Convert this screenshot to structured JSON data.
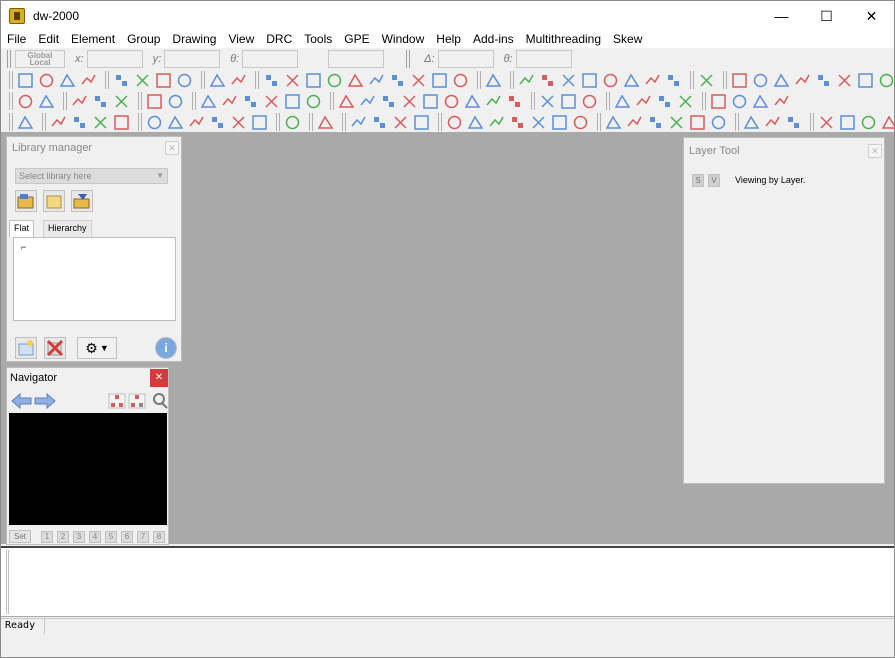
{
  "window": {
    "title": "dw-2000",
    "minimize_glyph": "—",
    "maximize_glyph": "☐",
    "close_glyph": "✕"
  },
  "menu": [
    "File",
    "Edit",
    "Element",
    "Group",
    "Drawing",
    "View",
    "DRC",
    "Tools",
    "GPE",
    "Window",
    "Help",
    "Add-ins",
    "Multithreading",
    "Skew"
  ],
  "coordbar": {
    "global_line1": "Global",
    "global_line2": "Local",
    "x_label": "x:",
    "y_label": "y:",
    "theta_label": "θ:",
    "delta_label": "Δ:",
    "theta2_label": "θ:"
  },
  "library_manager": {
    "title": "Library manager",
    "select_placeholder": "Select library here",
    "tabs": [
      "Flat",
      "Hierarchy"
    ]
  },
  "navigator": {
    "title": "Navigator",
    "set_label": "Set",
    "slots": [
      "1",
      "2",
      "3",
      "4",
      "5",
      "6",
      "7",
      "8"
    ]
  },
  "layer_tool": {
    "title": "Layer Tool",
    "s_label": "S",
    "v_label": "V",
    "status": "Viewing by Layer."
  },
  "statusbar": {
    "text": "Ready"
  },
  "icons": {
    "toolbar_color_primary": "#5b8fd6",
    "toolbar_color_secondary": "#d95b5b",
    "toolbar_color_tertiary": "#4caf50"
  }
}
